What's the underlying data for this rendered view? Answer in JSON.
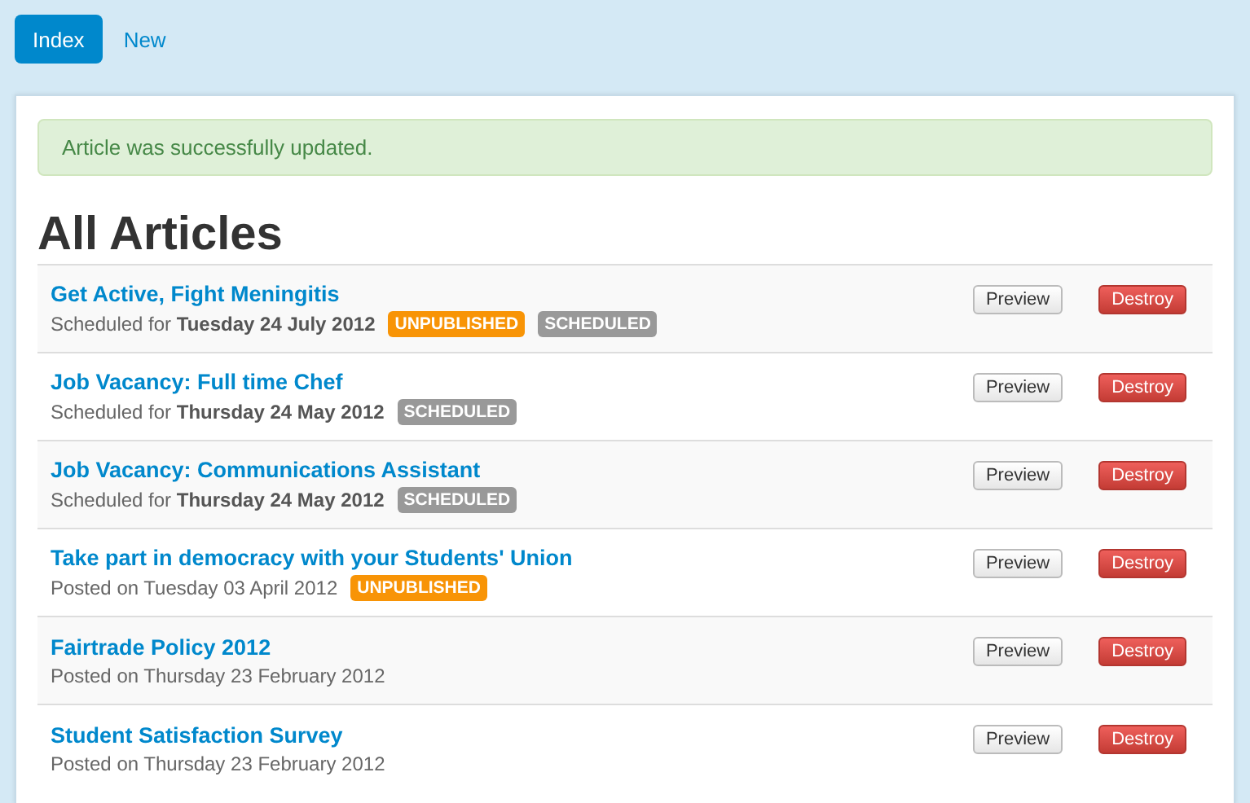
{
  "nav": [
    {
      "label": "Index",
      "selected": true
    },
    {
      "label": "New",
      "selected": false
    }
  ],
  "alert": {
    "text": "Article was successfully updated."
  },
  "heading": "All Articles",
  "articles": [
    {
      "title": "Get Active, Fight Meningitis",
      "meta": "Scheduled for **Tuesday 24 July 2012**",
      "badges": [
        {
          "kind": "unpublished",
          "label": "UNPUBLISHED"
        },
        {
          "kind": "scheduled",
          "label": "SCHEDULED"
        }
      ],
      "actions": [
        "Preview",
        "Destroy"
      ]
    },
    {
      "title": "Job Vacancy: Full time Chef",
      "meta": "Scheduled for **Thursday 24 May 2012**",
      "badges": [
        {
          "kind": "scheduled",
          "label": "SCHEDULED"
        }
      ],
      "actions": [
        "Preview",
        "Destroy"
      ]
    },
    {
      "title": "Job Vacancy: Communications Assistant",
      "meta": "Scheduled for **Thursday 24 May 2012**",
      "badges": [
        {
          "kind": "scheduled",
          "label": "SCHEDULED"
        }
      ],
      "actions": [
        "Preview",
        "Destroy"
      ]
    },
    {
      "title": "Take part in democracy with your Students' Union",
      "meta": "Posted on Tuesday 03 April 2012",
      "badges": [
        {
          "kind": "unpublished",
          "label": "UNPUBLISHED"
        }
      ],
      "actions": [
        "Preview",
        "Destroy"
      ]
    },
    {
      "title": "Fairtrade Policy 2012",
      "meta": "Posted on Thursday 23 February 2012",
      "actions": [
        "Preview",
        "Destroy"
      ]
    },
    {
      "title": "Student Satisfaction Survey",
      "meta": "Posted on Thursday 23 February 2012",
      "actions": [
        "Preview",
        "Destroy"
      ]
    }
  ]
}
